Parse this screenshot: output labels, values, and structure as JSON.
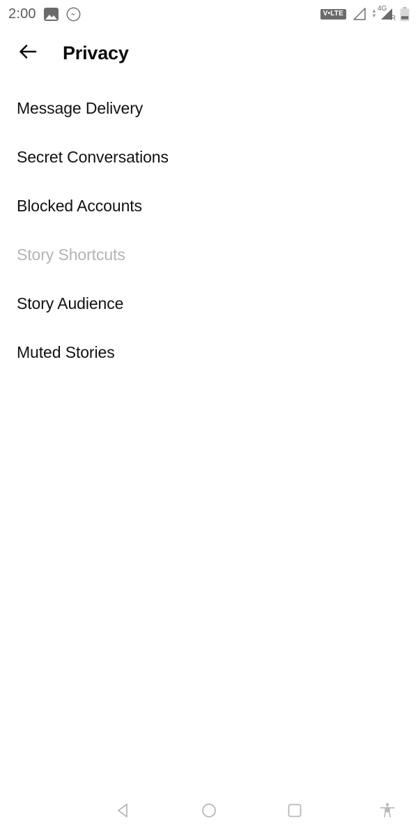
{
  "status_bar": {
    "time": "2:00",
    "left_icons": [
      {
        "name": "photo-icon",
        "label": "photo"
      },
      {
        "name": "messenger-icon",
        "label": "messenger"
      }
    ],
    "volte_label": "V•LTE",
    "network_type": "4G",
    "roaming_label": "R",
    "right_icons": [
      {
        "name": "volte-badge",
        "label": "V•LTE"
      },
      {
        "name": "signal-empty-icon",
        "label": "signal no bars"
      },
      {
        "name": "signal-4g-icon",
        "label": "4G signal roaming"
      },
      {
        "name": "battery-icon",
        "label": "battery low"
      }
    ],
    "icon_color": "#6b6b6b",
    "time_color": "#5a5a5a"
  },
  "header": {
    "back_icon": "arrow-left-icon",
    "title": "Privacy"
  },
  "list": {
    "items": [
      {
        "label": "Message Delivery",
        "disabled": false,
        "name": "list-item-message-delivery"
      },
      {
        "label": "Secret Conversations",
        "disabled": false,
        "name": "list-item-secret-conversations"
      },
      {
        "label": "Blocked Accounts",
        "disabled": false,
        "name": "list-item-blocked-accounts"
      },
      {
        "label": "Story Shortcuts",
        "disabled": true,
        "name": "list-item-story-shortcuts"
      },
      {
        "label": "Story Audience",
        "disabled": false,
        "name": "list-item-story-audience"
      },
      {
        "label": "Muted Stories",
        "disabled": false,
        "name": "list-item-muted-stories"
      }
    ],
    "text_color": "#111111",
    "disabled_color": "#b4b4b4"
  },
  "navbar": {
    "buttons": [
      {
        "name": "nav-back-button",
        "icon": "triangle-left-icon"
      },
      {
        "name": "nav-home-button",
        "icon": "circle-icon"
      },
      {
        "name": "nav-recents-button",
        "icon": "square-icon"
      },
      {
        "name": "nav-accessibility-button",
        "icon": "accessibility-person-icon"
      }
    ],
    "icon_color": "#b8b8b8"
  }
}
